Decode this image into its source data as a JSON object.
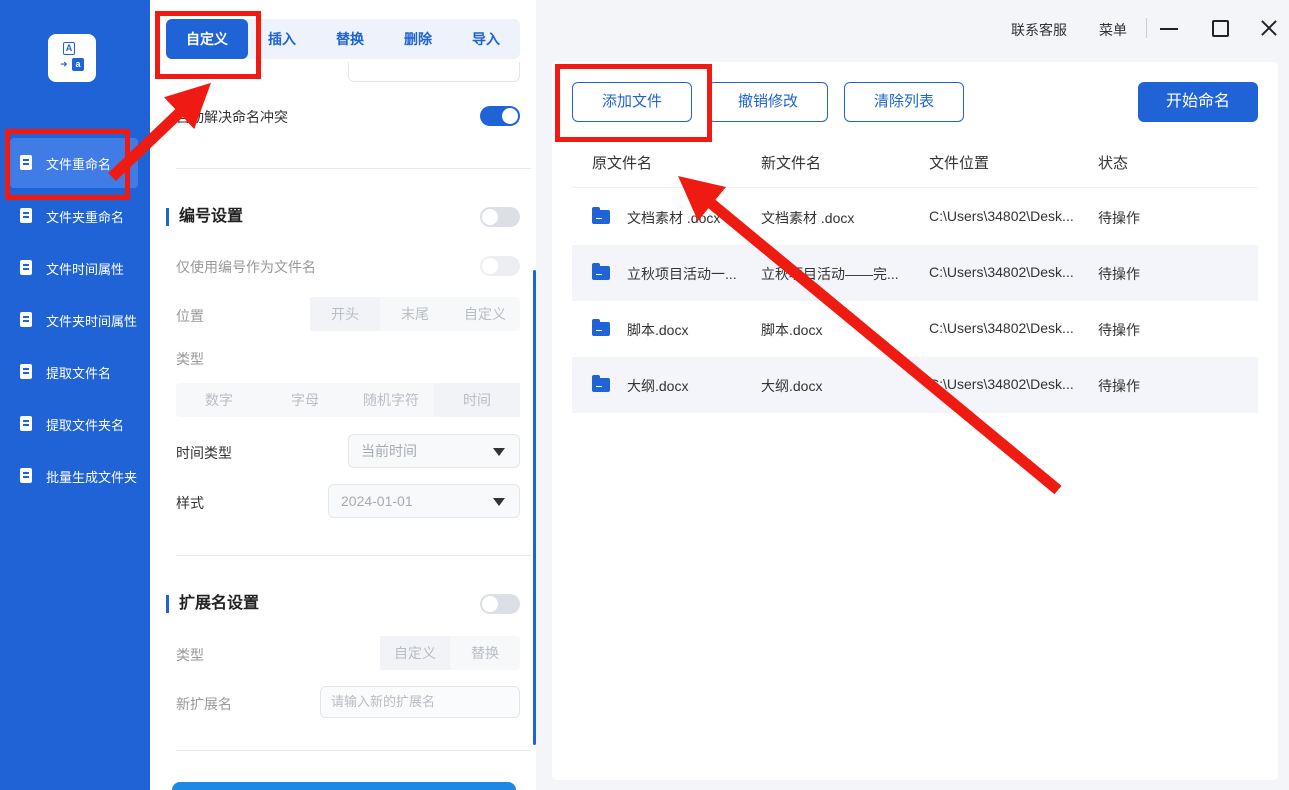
{
  "sidebar": {
    "logo_letters": [
      "A",
      "a"
    ],
    "items": [
      {
        "label": "文件重命名",
        "icon": "file-edit-icon",
        "active": true
      },
      {
        "label": "文件夹重命名",
        "icon": "folder-edit-icon",
        "active": false
      },
      {
        "label": "文件时间属性",
        "icon": "file-clock-icon",
        "active": false
      },
      {
        "label": "文件夹时间属性",
        "icon": "folder-clock-icon",
        "active": false
      },
      {
        "label": "提取文件名",
        "icon": "file-extract-icon",
        "active": false
      },
      {
        "label": "提取文件夹名",
        "icon": "folder-extract-icon",
        "active": false
      },
      {
        "label": "批量生成文件夹",
        "icon": "folders-batch-icon",
        "active": false
      }
    ]
  },
  "panel": {
    "tabs": [
      "自定义",
      "插入",
      "替换",
      "删除",
      "导入"
    ],
    "active_tab": "自定义",
    "auto_conflict_label": "自动解决命名冲突",
    "numbering": {
      "title": "编号设置",
      "only_number_label": "仅使用编号作为文件名",
      "position_label": "位置",
      "position_options": [
        "开头",
        "末尾",
        "自定义"
      ],
      "type_label": "类型",
      "type_options": [
        "数字",
        "字母",
        "随机字符",
        "时间"
      ],
      "time_type_label": "时间类型",
      "time_type_value": "当前时间",
      "style_label": "样式",
      "style_value": "2024-01-01"
    },
    "extension": {
      "title": "扩展名设置",
      "type_label": "类型",
      "type_options": [
        "自定义",
        "替换"
      ],
      "new_ext_label": "新扩展名",
      "new_ext_placeholder": "请输入新的扩展名"
    }
  },
  "topbar": {
    "support": "联系客服",
    "menu": "菜单"
  },
  "main": {
    "buttons": {
      "add_file": "添加文件",
      "undo": "撤销修改",
      "clear": "清除列表",
      "start": "开始命名"
    },
    "columns": [
      "原文件名",
      "新文件名",
      "文件位置",
      "状态"
    ],
    "rows": [
      {
        "orig": "文档素材 .docx",
        "new": "文档素材 .docx",
        "path": "C:\\Users\\34802\\Desk...",
        "status": "待操作"
      },
      {
        "orig": "立秋项目活动一...",
        "new": "立秋项目活动——完...",
        "path": "C:\\Users\\34802\\Desk...",
        "status": "待操作"
      },
      {
        "orig": "脚本.docx",
        "new": "脚本.docx",
        "path": "C:\\Users\\34802\\Desk...",
        "status": "待操作"
      },
      {
        "orig": "大纲.docx",
        "new": "大纲.docx",
        "path": "C:\\Users\\34802\\Desk...",
        "status": "待操作"
      }
    ]
  },
  "colors": {
    "brand": "#1f63d6",
    "annotation": "#ef1b12"
  }
}
